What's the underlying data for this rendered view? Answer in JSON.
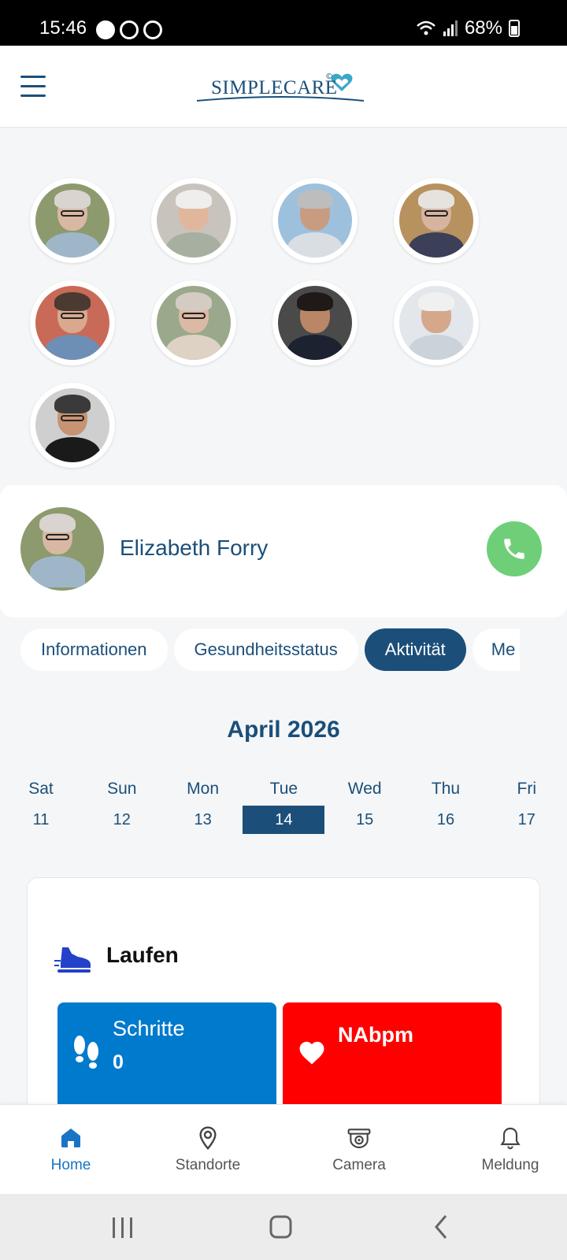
{
  "status_bar": {
    "time": "15:46",
    "battery": "68%"
  },
  "header": {
    "logo_text": "SIMPLECARE",
    "logo_mark": "©"
  },
  "residents": [
    {
      "palette": {
        "bg": "#8c9a6e",
        "skin": "#d9b8a3",
        "hair": "#d9d4d0",
        "body": "#9fb6c9"
      },
      "glasses": true
    },
    {
      "palette": {
        "bg": "#c9c3bd",
        "skin": "#e0b79c",
        "hair": "#f0eeec",
        "body": "#a7b0a0"
      },
      "glasses": false
    },
    {
      "palette": {
        "bg": "#9dc0dd",
        "skin": "#c89c80",
        "hair": "#bdbdbd",
        "body": "#d9dee3"
      },
      "glasses": false
    },
    {
      "palette": {
        "bg": "#b7925f",
        "skin": "#d7b4a0",
        "hair": "#e6e2de",
        "body": "#3b3f58"
      },
      "glasses": true
    },
    {
      "palette": {
        "bg": "#c96a58",
        "skin": "#d9a98e",
        "hair": "#4a3a32",
        "body": "#6e8fb5"
      },
      "glasses": true
    },
    {
      "palette": {
        "bg": "#9aa98c",
        "skin": "#dcb9a4",
        "hair": "#d4cbc2",
        "body": "#ddd2c4"
      },
      "glasses": true
    },
    {
      "palette": {
        "bg": "#4a4a4a",
        "skin": "#b98766",
        "hair": "#1f1a17",
        "body": "#1c2230"
      },
      "glasses": false
    },
    {
      "palette": {
        "bg": "#e3e6ea",
        "skin": "#d5a88c",
        "hair": "#f0f0f0",
        "body": "#cbd3da"
      },
      "glasses": false
    },
    {
      "palette": {
        "bg": "#cfcfcf",
        "skin": "#c69373",
        "hair": "#3a3a3a",
        "body": "#1a1a1a"
      },
      "glasses": true
    }
  ],
  "selected_person": {
    "name": "Elizabeth Forry",
    "palette": {
      "bg": "#8c9a6e",
      "skin": "#d9b8a3",
      "hair": "#d9d4d0",
      "body": "#9fb6c9"
    }
  },
  "tabs": [
    {
      "label": "Informationen",
      "active": false
    },
    {
      "label": "Gesundheitsstatus",
      "active": false
    },
    {
      "label": "Aktivität",
      "active": true
    },
    {
      "label": "Me",
      "active": false
    }
  ],
  "calendar": {
    "month": "April 2026",
    "days": [
      {
        "name": "Sat",
        "num": "11"
      },
      {
        "name": "Sun",
        "num": "12"
      },
      {
        "name": "Mon",
        "num": "13"
      },
      {
        "name": "Tue",
        "num": "14",
        "selected": true
      },
      {
        "name": "Wed",
        "num": "15"
      },
      {
        "name": "Thu",
        "num": "16"
      },
      {
        "name": "Fri",
        "num": "17"
      }
    ]
  },
  "activity": {
    "title": "Laufen",
    "steps_label": "Schritte",
    "steps_value": "0",
    "heart_rate": "NAbpm"
  },
  "bottom_nav": [
    {
      "label": "Home",
      "icon": "home-icon",
      "active": true
    },
    {
      "label": "Standorte",
      "icon": "location-pin-icon",
      "active": false
    },
    {
      "label": "Camera",
      "icon": "camera-icon",
      "active": false
    },
    {
      "label": "Meldung",
      "icon": "bell-icon",
      "active": false
    }
  ],
  "colors": {
    "brand": "#1b4f7a",
    "active_nav": "#1a74c4",
    "call": "#6fcf78",
    "steps_tile": "#007acc",
    "heart_tile": "#ff0000"
  }
}
